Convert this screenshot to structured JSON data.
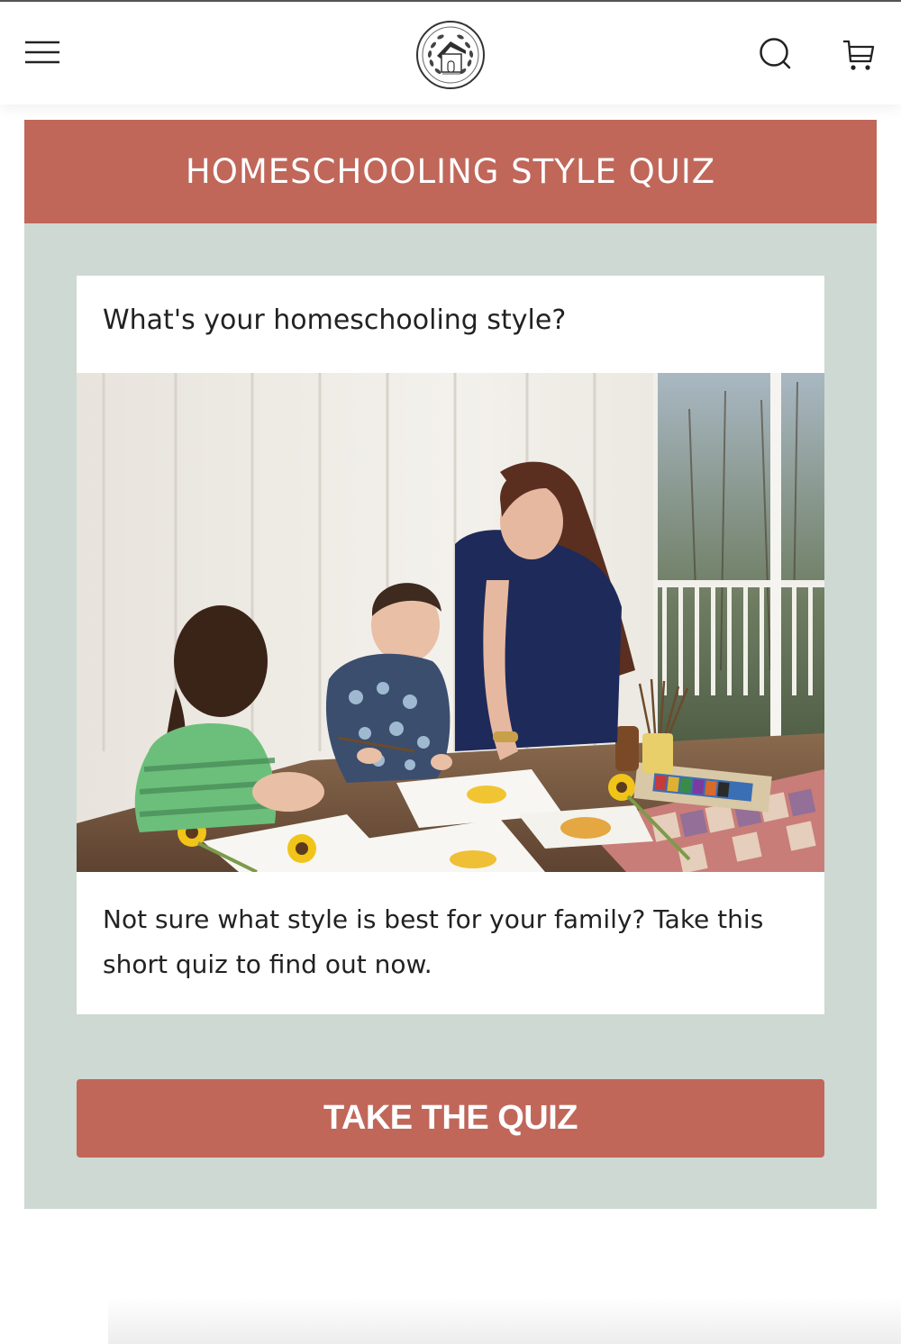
{
  "header": {
    "menu_icon": "hamburger-menu-icon",
    "logo_icon": "house-wreath-logo",
    "search_icon": "search-icon",
    "cart_icon": "cart-icon"
  },
  "quiz": {
    "banner_title": "HOMESCHOOLING STYLE QUIZ",
    "question": "What's your homeschooling style?",
    "description": "Not sure what style is best for your family? Take this short quiz to find out now.",
    "cta_label": "TAKE THE QUIZ"
  },
  "colors": {
    "accent": "#c0675a",
    "section_bg": "#cdd9d2",
    "card_bg": "#ffffff"
  }
}
